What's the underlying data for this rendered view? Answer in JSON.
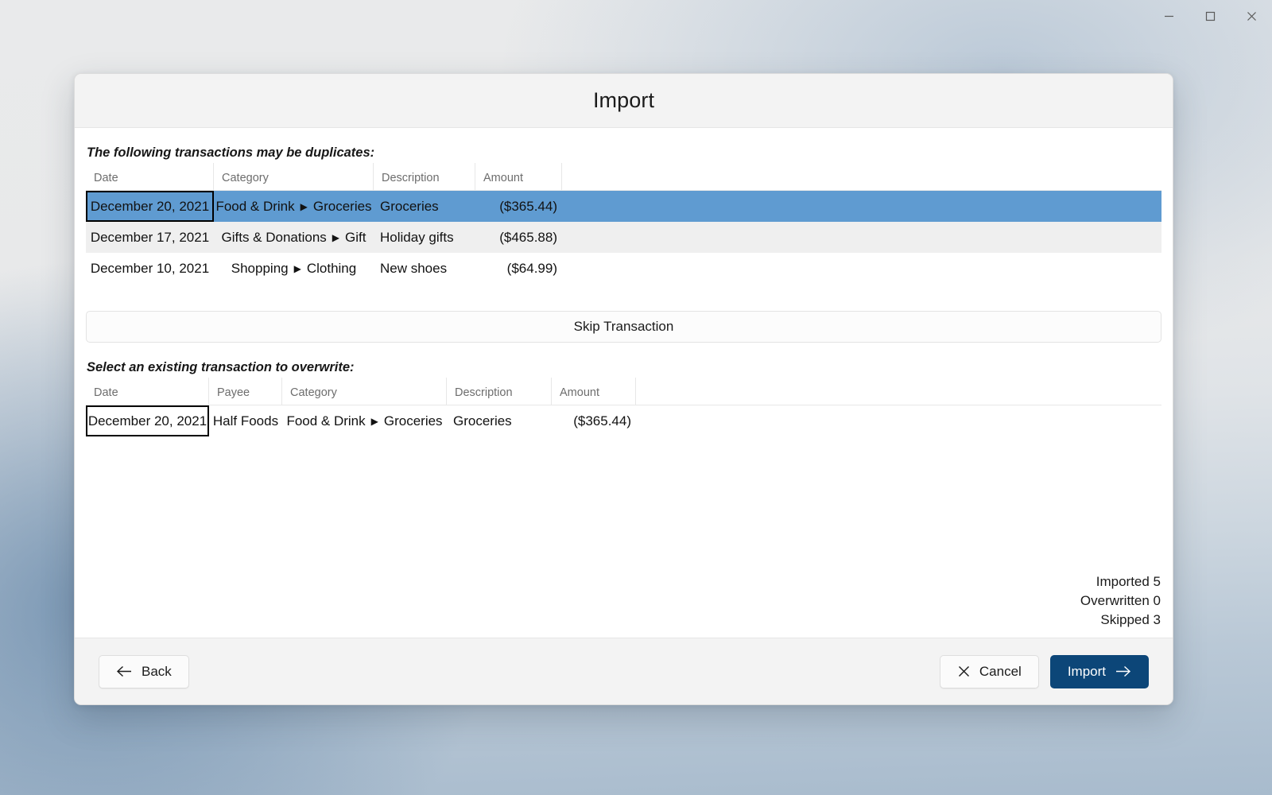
{
  "window": {
    "controls": [
      {
        "name": "minimize",
        "glyph": "minimize-icon"
      },
      {
        "name": "maximize",
        "glyph": "maximize-icon"
      },
      {
        "name": "close",
        "glyph": "close-icon"
      }
    ]
  },
  "dialog": {
    "title": "Import",
    "duplicates_label": "The following transactions may be duplicates:",
    "overwrite_label": "Select an existing transaction to overwrite:",
    "skip_button": "Skip Transaction"
  },
  "duplicates_grid": {
    "columns": [
      "Date",
      "Category",
      "Description",
      "Amount"
    ],
    "rows": [
      {
        "date": "December 20, 2021",
        "category_parent": "Food & Drink",
        "category_child": "Groceries",
        "description": "Groceries",
        "amount": "($365.44)",
        "selected": true,
        "focused": true
      },
      {
        "date": "December 17, 2021",
        "category_parent": "Gifts & Donations",
        "category_child": "Gift",
        "description": "Holiday gifts",
        "amount": "($465.88)",
        "selected": false,
        "focused": false
      },
      {
        "date": "December 10, 2021",
        "category_parent": "Shopping",
        "category_child": "Clothing",
        "description": "New shoes",
        "amount": "($64.99)",
        "selected": false,
        "focused": false
      }
    ]
  },
  "existing_grid": {
    "columns": [
      "Date",
      "Payee",
      "Category",
      "Description",
      "Amount"
    ],
    "rows": [
      {
        "date": "December 20, 2021",
        "payee": "Half Foods",
        "category_parent": "Food & Drink",
        "category_child": "Groceries",
        "description": "Groceries",
        "amount": "($365.44)",
        "selected": false,
        "focused": true
      }
    ]
  },
  "summary": {
    "imported": "Imported 5",
    "overwritten": "Overwritten 0",
    "skipped": "Skipped 3"
  },
  "footer": {
    "back": "Back",
    "cancel": "Cancel",
    "import": "Import"
  },
  "colors": {
    "selection_blue": "#5f9bd1",
    "primary_navy": "#0c4678",
    "alt_row": "#efefef",
    "header_bg": "#f3f3f3"
  }
}
